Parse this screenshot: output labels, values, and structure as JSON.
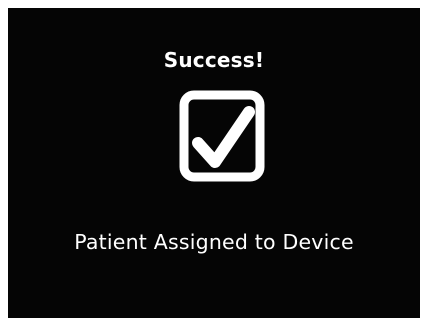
{
  "dialog": {
    "title": "Success!",
    "icon": "checkbox-checked-icon",
    "message": "Patient Assigned to Device"
  },
  "colors": {
    "background": "#050505",
    "foreground": "#ffffff",
    "page": "#ffffff"
  }
}
